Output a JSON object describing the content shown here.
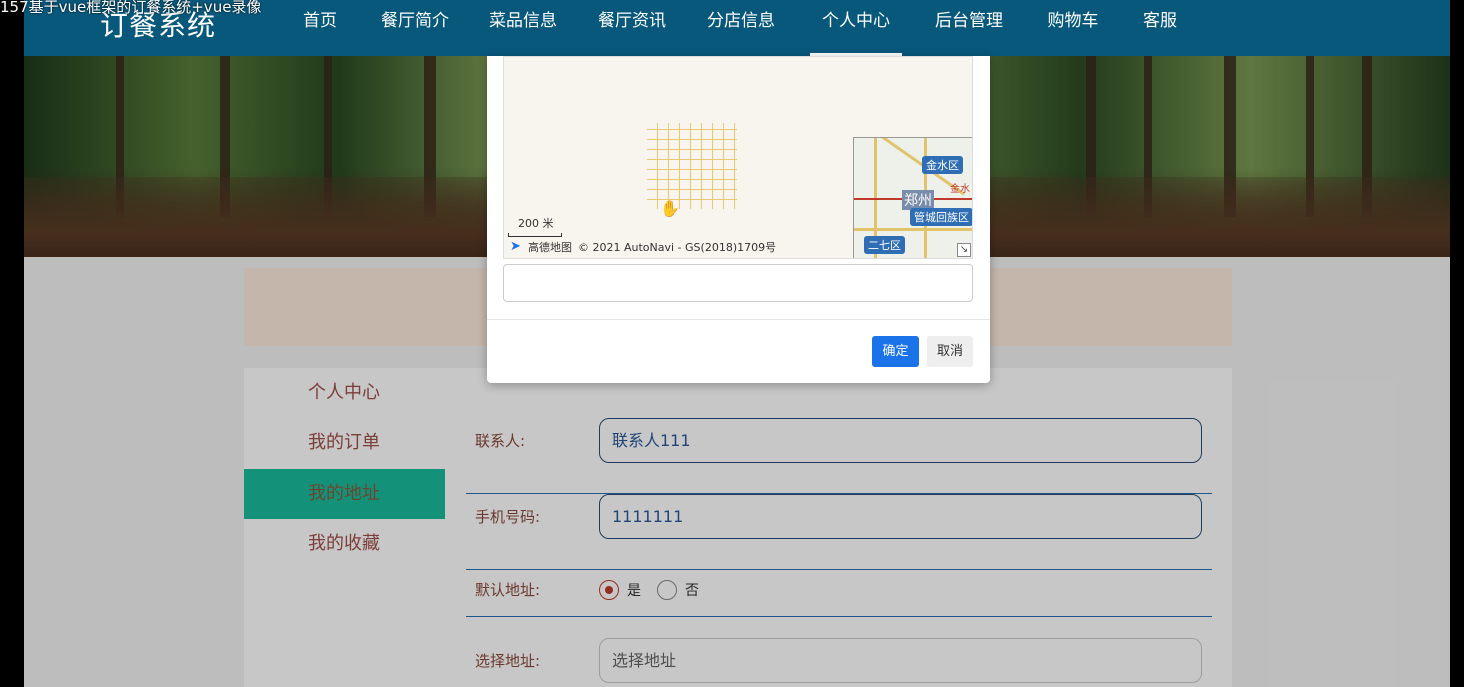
{
  "recording_title": "157基于vue框架的订餐系统+vue录像",
  "nav": {
    "logo": "订餐系统",
    "items": [
      {
        "label": "首页"
      },
      {
        "label": "餐厅简介"
      },
      {
        "label": "菜品信息"
      },
      {
        "label": "餐厅资讯"
      },
      {
        "label": "分店信息"
      },
      {
        "label": "个人中心",
        "active": true
      },
      {
        "label": "后台管理"
      },
      {
        "label": "购物车"
      },
      {
        "label": "客服"
      }
    ]
  },
  "sidebar": {
    "items": [
      {
        "label": "个人中心"
      },
      {
        "label": "我的订单"
      },
      {
        "label": "我的地址",
        "active": true
      },
      {
        "label": "我的收藏"
      }
    ]
  },
  "form": {
    "contact_label": "联系人:",
    "contact_value": "联系人111",
    "phone_label": "手机号码:",
    "phone_value": "1111111",
    "default_label": "默认地址:",
    "default_yes": "是",
    "default_no": "否",
    "default_selected": "是",
    "address_label": "选择地址:",
    "address_placeholder": "选择地址"
  },
  "modal": {
    "map": {
      "scale": "200 米",
      "provider": "高德地图",
      "copyright": "© 2021 AutoNavi - GS(2018)1709号",
      "mini_labels": {
        "district1": "金水区",
        "district2": "管城回族区",
        "district3": "二七区",
        "city": "郑州",
        "road": "金水"
      }
    },
    "confirm_label": "确定",
    "cancel_label": "取消"
  },
  "colors": {
    "nav_bg": "#08587c",
    "sidebar_active": "#1abc9c",
    "confirm_button": "#1a73e8"
  }
}
